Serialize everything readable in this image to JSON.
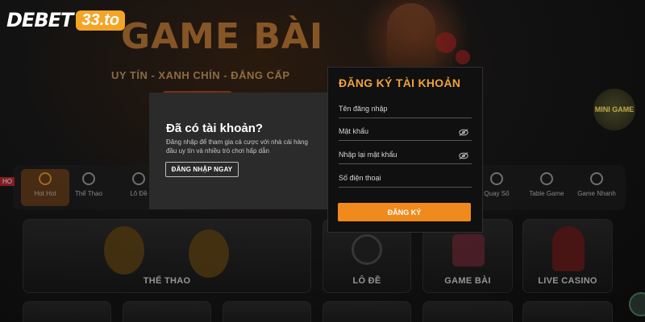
{
  "brand": {
    "logo_text": "DEBET",
    "logo_tag": "33.to"
  },
  "banner": {
    "title": "GAME BÀI",
    "subtitle": "UY TÍN - XANH CHÍN - ĐẲNG CẤP",
    "badge": "MINI GAME"
  },
  "nav": {
    "items": [
      {
        "label": "Hot Hot",
        "icon": "hot-icon"
      },
      {
        "label": "Thể Thao",
        "icon": "soccer-ball-icon"
      },
      {
        "label": "Lô Đề",
        "icon": "lottery-icon"
      },
      {
        "label": "Quay Số",
        "icon": "dice-icon"
      },
      {
        "label": "Table Game",
        "icon": "chips-icon"
      },
      {
        "label": "Game Nhanh",
        "icon": "lightning-icon"
      }
    ]
  },
  "cards": {
    "sports": "THỂ THAO",
    "lode": "LÔ ĐỀ",
    "gamebai": "GAME BÀI",
    "casino": "LIVE CASINO"
  },
  "login_panel": {
    "title": "Đã có tài khoản?",
    "description": "Đăng nhập để tham gia cá cược với nhà cái hàng đầu uy tín và nhiều trò chơi hấp dẫn",
    "button": "ĐĂNG NHẬP NGAY"
  },
  "register_panel": {
    "title": "ĐĂNG KÝ TÀI KHOẢN",
    "fields": [
      {
        "placeholder": "Tên đăng nhập",
        "icon": ""
      },
      {
        "placeholder": "Mật khẩu",
        "icon": "eye-off-icon"
      },
      {
        "placeholder": "Nhập lại mật khẩu",
        "icon": "eye-off-icon"
      },
      {
        "placeholder": "Số điện thoại",
        "icon": ""
      }
    ],
    "button": "ĐĂNG KÝ"
  },
  "colors": {
    "accent": "#f08a1c",
    "title_orange": "#f0a23a",
    "panel_dark": "#101010",
    "panel_gray": "#2b2b2b"
  }
}
